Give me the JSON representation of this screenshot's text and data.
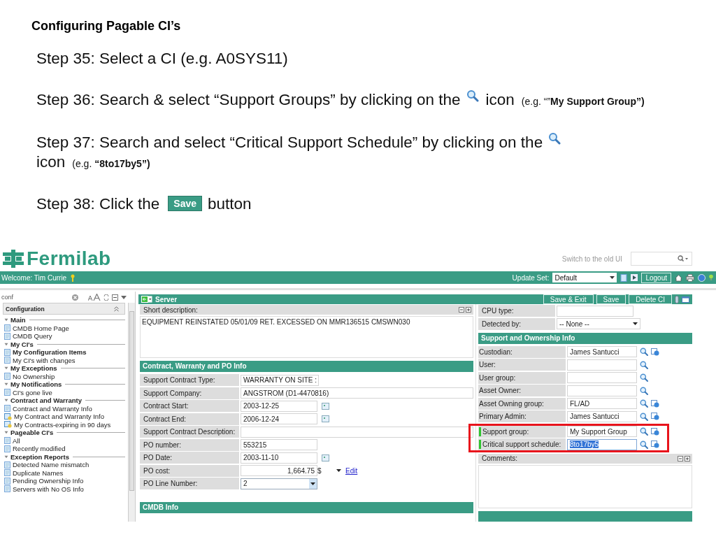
{
  "slide": {
    "title": "Configuring Pagable CI’s",
    "steps": [
      {
        "parts": [
          {
            "kind": "text",
            "text": "Step 35: Select a CI (e.g. A0SYS11)"
          }
        ]
      },
      {
        "parts": [
          {
            "kind": "text",
            "text": "Step 36: Search & select “Support Groups” by clicking on the"
          },
          {
            "kind": "search_icon"
          },
          {
            "kind": "text",
            "text": "icon"
          },
          {
            "kind": "note",
            "text": "(e.g. “”**My Support Group”)**"
          }
        ]
      },
      {
        "parts": [
          {
            "kind": "text",
            "text": "Step 37: Search and select “Critical Support Schedule” by clicking on the"
          },
          {
            "kind": "search_icon"
          },
          {
            "kind": "text",
            "text": "icon"
          },
          {
            "kind": "note",
            "text": "(e.g. **“8to17by5”)**"
          }
        ]
      },
      {
        "parts": [
          {
            "kind": "text",
            "text": "Step 38: Click the"
          },
          {
            "kind": "button",
            "text": "Save"
          },
          {
            "kind": "text",
            "text": "button"
          }
        ]
      }
    ]
  },
  "app": {
    "logo": "Fermilab",
    "switch_link": "Switch to the old UI",
    "welcome": "Welcome: Tim Currie",
    "update_set": {
      "label": "Update Set:",
      "value": "Default"
    },
    "logout": "Logout",
    "nav_filter": {
      "value": "conf"
    },
    "nav_title": "Configuration",
    "nav": [
      {
        "label": "Main",
        "expanded": true,
        "children": [
          {
            "label": "CMDB Home Page",
            "kind": "page",
            "selected": false
          },
          {
            "label": "CMDB Query",
            "kind": "page",
            "selected": false
          }
        ]
      },
      {
        "label": "My CI's",
        "expanded": true,
        "children": [
          {
            "label": "My Configuration Items",
            "kind": "page",
            "selected": true
          },
          {
            "label": "My CI's with changes",
            "kind": "page",
            "selected": false
          }
        ]
      },
      {
        "label": "My Exceptions",
        "expanded": true,
        "children": [
          {
            "label": "No Ownership",
            "kind": "page",
            "selected": false
          }
        ]
      },
      {
        "label": "My Notifications",
        "expanded": true,
        "children": [
          {
            "label": "CI's gone live",
            "kind": "page",
            "selected": false
          }
        ]
      },
      {
        "label": "Contract and Warranty",
        "expanded": true,
        "children": [
          {
            "label": "Contract and Warranty Info",
            "kind": "page",
            "selected": false
          },
          {
            "label": "My Contract and Warranty Info",
            "kind": "shared",
            "selected": false
          },
          {
            "label": "My Contracts-expiring in 90 days",
            "kind": "shared",
            "selected": false
          }
        ]
      },
      {
        "label": "Pageable CI's",
        "expanded": true,
        "children": [
          {
            "label": "All",
            "kind": "page",
            "selected": false
          },
          {
            "label": "Recently modified",
            "kind": "page",
            "selected": false
          }
        ]
      },
      {
        "label": "Exception Reports",
        "expanded": true,
        "children": [
          {
            "label": "Detected Name mismatch",
            "kind": "page",
            "selected": false
          },
          {
            "label": "Duplicate Names",
            "kind": "page",
            "selected": false
          },
          {
            "label": "Pending Ownership Info",
            "kind": "page",
            "selected": false
          },
          {
            "label": "Servers with No OS Info",
            "kind": "page",
            "selected": false
          }
        ]
      }
    ],
    "form": {
      "title": "Server",
      "buttons": [
        "Save & Exit",
        "Save",
        "Delete CI"
      ],
      "short_description": {
        "label": "Short description:",
        "value": "EQUIPMENT REINSTATED 05/01/09 RET.  EXCESSED ON MMR136515 CMSWN030"
      },
      "contract_section": {
        "title": "Contract, Warranty and PO Info",
        "rows": [
          {
            "kind": "select",
            "label": "Support Contract Type:",
            "value": "WARRANTY ON SITE :"
          },
          {
            "kind": "wide",
            "label": "Support Company:",
            "value": "ANGSTROM (D1-4470816)"
          },
          {
            "kind": "date",
            "label": "Contract Start:",
            "value": "2003-12-25"
          },
          {
            "kind": "date",
            "label": "Contract End:",
            "value": "2006-12-24"
          },
          {
            "kind": "wide",
            "label": "Support Contract Description:"
          },
          {
            "kind": "text",
            "label": "PO number:",
            "value": "553215"
          },
          {
            "kind": "date",
            "label": "PO Date:",
            "value": "2003-11-10"
          },
          {
            "kind": "currency",
            "label": "PO cost:",
            "value": "1,664.75",
            "currency": "$",
            "link": "Edit"
          },
          {
            "kind": "choice",
            "label": "PO Line Number:",
            "value": "2"
          }
        ]
      },
      "top_right_rows": [
        {
          "kind": "text",
          "label": "CPU type:"
        },
        {
          "kind": "select",
          "label": "Detected by:",
          "value": "-- None --"
        }
      ],
      "ownership_section": {
        "title": "Support and Ownership Info",
        "rows": [
          {
            "label": "Custodian:",
            "value": "James Santucci",
            "info": true,
            "mandatory": false,
            "highlighted": false,
            "text_selected": false
          },
          {
            "label": "User:",
            "info": false,
            "mandatory": false,
            "highlighted": false,
            "text_selected": false
          },
          {
            "label": "User group:",
            "info": false,
            "mandatory": false,
            "highlighted": false,
            "text_selected": false
          },
          {
            "label": "Asset Owner:",
            "info": false,
            "mandatory": false,
            "highlighted": false,
            "text_selected": false
          },
          {
            "label": "Asset Owning group:",
            "value": "FL/AD",
            "info": true,
            "mandatory": false,
            "highlighted": false,
            "text_selected": false
          },
          {
            "label": "Primary Admin:",
            "value": "James Santucci",
            "info": true,
            "mandatory": false,
            "highlighted": false,
            "text_selected": false
          },
          {
            "label": "Support group:",
            "value": "My Support Group",
            "info": true,
            "mandatory": true,
            "highlighted": true,
            "text_selected": false
          },
          {
            "label": "Critical support schedule:",
            "value": "8to17by5",
            "info": true,
            "mandatory": true,
            "highlighted": true,
            "text_selected": true
          }
        ]
      },
      "comments_label": "Comments:",
      "cmdb_section": "CMDB Info"
    }
  }
}
